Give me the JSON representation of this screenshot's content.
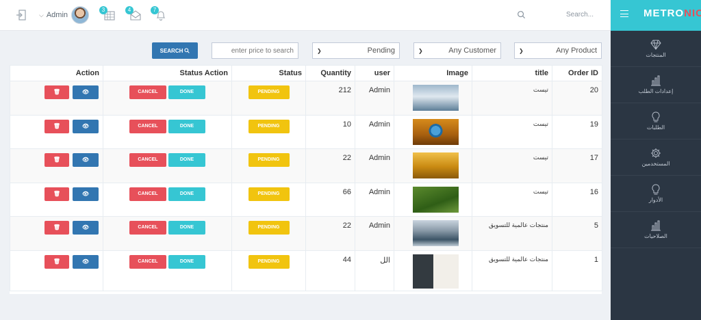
{
  "header": {
    "user_name": "Admin",
    "search_placeholder": "Search...",
    "badges": {
      "calendar": "3",
      "mail": "4",
      "bell": "7"
    }
  },
  "brand": {
    "part1": "METRO",
    "part2": "NIC",
    "accent_color": "#e7505a",
    "bar_color": "#36c6d3"
  },
  "sidebar": {
    "items": [
      {
        "label": "المنتجات",
        "icon": "diamond-icon"
      },
      {
        "label": "إعدادات الطلب",
        "icon": "bar-chart-icon"
      },
      {
        "label": "الطلبات",
        "icon": "bulb-icon"
      },
      {
        "label": "المستخدمين",
        "icon": "gear-icon"
      },
      {
        "label": "الأدوار",
        "icon": "bulb-icon"
      },
      {
        "label": "الصلاحيات",
        "icon": "bar-chart-icon"
      }
    ]
  },
  "filters": {
    "search_button": "SEARCH",
    "price_placeholder": "enter price to search",
    "status_selected": "Pending",
    "customer_selected": "Any Customer",
    "product_selected": "Any Product"
  },
  "table": {
    "headers": {
      "action": "Action",
      "status_action": "Status Action",
      "status": "Status",
      "quantity": "Quantity",
      "user": "user",
      "image": "Image",
      "title": "title",
      "order_id": "Order ID"
    },
    "buttons": {
      "cancel": "CANCEL",
      "done": "DONE"
    },
    "rows": [
      {
        "order_id": "20",
        "title": "تيست",
        "user": "Admin",
        "quantity": "212",
        "status": "PENDING"
      },
      {
        "order_id": "19",
        "title": "تيست",
        "user": "Admin",
        "quantity": "10",
        "status": "PENDING"
      },
      {
        "order_id": "17",
        "title": "تيست",
        "user": "Admin",
        "quantity": "22",
        "status": "PENDING"
      },
      {
        "order_id": "16",
        "title": "تيست",
        "user": "Admin",
        "quantity": "66",
        "status": "PENDING"
      },
      {
        "order_id": "5",
        "title": "منتجات عالمية للتسويق",
        "user": "Admin",
        "quantity": "22",
        "status": "PENDING"
      },
      {
        "order_id": "1",
        "title": "منتجات عالمية للتسويق",
        "user": "الل",
        "quantity": "44",
        "status": "PENDING"
      }
    ]
  }
}
